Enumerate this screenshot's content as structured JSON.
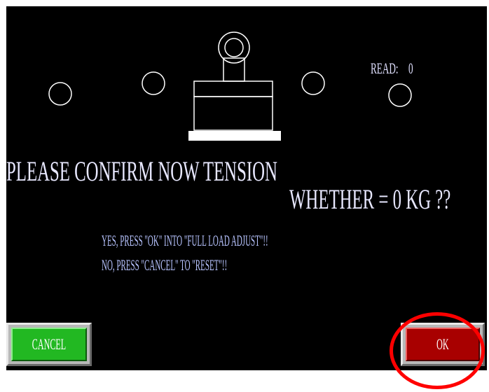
{
  "screen": {
    "prompt_line1": "PLEASE CONFIRM NOW TENSION",
    "prompt_line2": "WHETHER = 0 KG ??",
    "hint_yes": "YES, PRESS \"OK\" INTO \"FULL LOAD ADJUST\"!!",
    "hint_no": "NO, PRESS \"CANCEL\" TO \"RESET\"!!",
    "read_label": "READ:",
    "read_value": "0"
  },
  "buttons": {
    "cancel_label": "CANCEL",
    "ok_label": "OK"
  },
  "colors": {
    "background": "#000000",
    "cancel": "#22b822",
    "ok": "#a80000",
    "highlight": "#ff0000"
  },
  "icons": {
    "load_cell": "load-cell-weight-icon",
    "pulleys": "pulley-circle-icon"
  }
}
